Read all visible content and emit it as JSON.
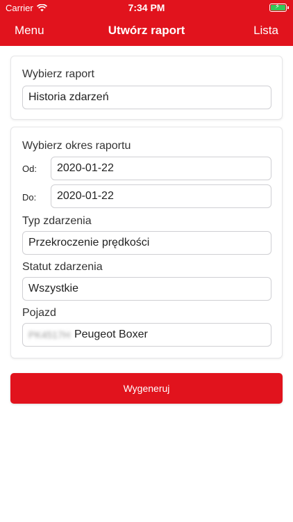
{
  "status_bar": {
    "carrier": "Carrier",
    "time": "7:34 PM",
    "battery_color": "#35c759"
  },
  "nav": {
    "left": "Menu",
    "title": "Utwórz raport",
    "right": "Lista"
  },
  "report": {
    "label": "Wybierz raport",
    "value": "Historia zdarzeń"
  },
  "period": {
    "label": "Wybierz okres raportu",
    "from_label": "Od:",
    "from_value": "2020-01-22",
    "to_label": "Do:",
    "to_value": "2020-01-22",
    "event_type_label": "Typ zdarzenia",
    "event_type_value": "Przekroczenie prędkości",
    "event_status_label": "Statut zdarzenia",
    "event_status_value": "Wszystkie",
    "vehicle_label": "Pojazd",
    "vehicle_plate": "PK4517H",
    "vehicle_name": "Peugeot Boxer"
  },
  "generate_button": "Wygeneruj",
  "colors": {
    "accent": "#e1131d"
  },
  "icons": {
    "wifi": "wifi-icon",
    "battery": "battery-icon"
  }
}
